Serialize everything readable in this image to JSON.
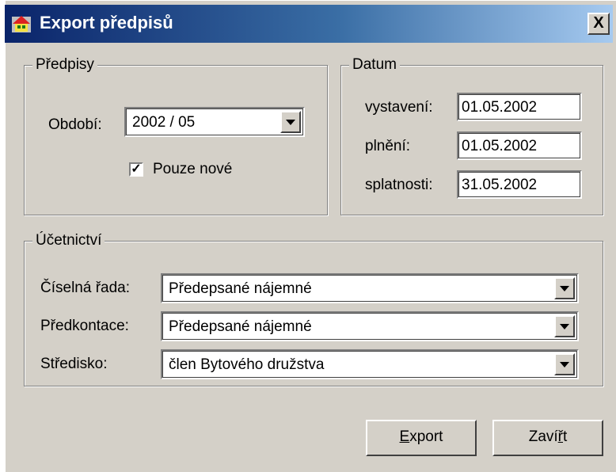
{
  "window": {
    "title": "Export předpisů",
    "close_label": "X"
  },
  "predpisy": {
    "legend": "Předpisy",
    "obdobi_label": "Období:",
    "obdobi_value": "2002 / 05",
    "pouze_nove_label": "Pouze nové",
    "pouze_nove_checked": true
  },
  "datum": {
    "legend": "Datum",
    "vystaveni_label": "vystavení:",
    "vystaveni_value": "01.05.2002",
    "plneni_label": "plnění:",
    "plneni_value": "01.05.2002",
    "splatnosti_label": "splatnosti:",
    "splatnosti_value": "31.05.2002"
  },
  "ucetnictvi": {
    "legend": "Účetnictví",
    "ciselna_rada_label": "Číselná řada:",
    "ciselna_rada_value": "Předepsané nájemné",
    "predkontace_label": "Předkontace:",
    "predkontace_value": "Předepsané nájemné",
    "stredisko_label": "Středisko:",
    "stredisko_value": "člen Bytového družstva"
  },
  "buttons": {
    "export_first": "E",
    "export_rest": "xport",
    "zavrit_first": "Zaví",
    "zavrit_mnemonic": "ř",
    "zavrit_rest": "t"
  }
}
